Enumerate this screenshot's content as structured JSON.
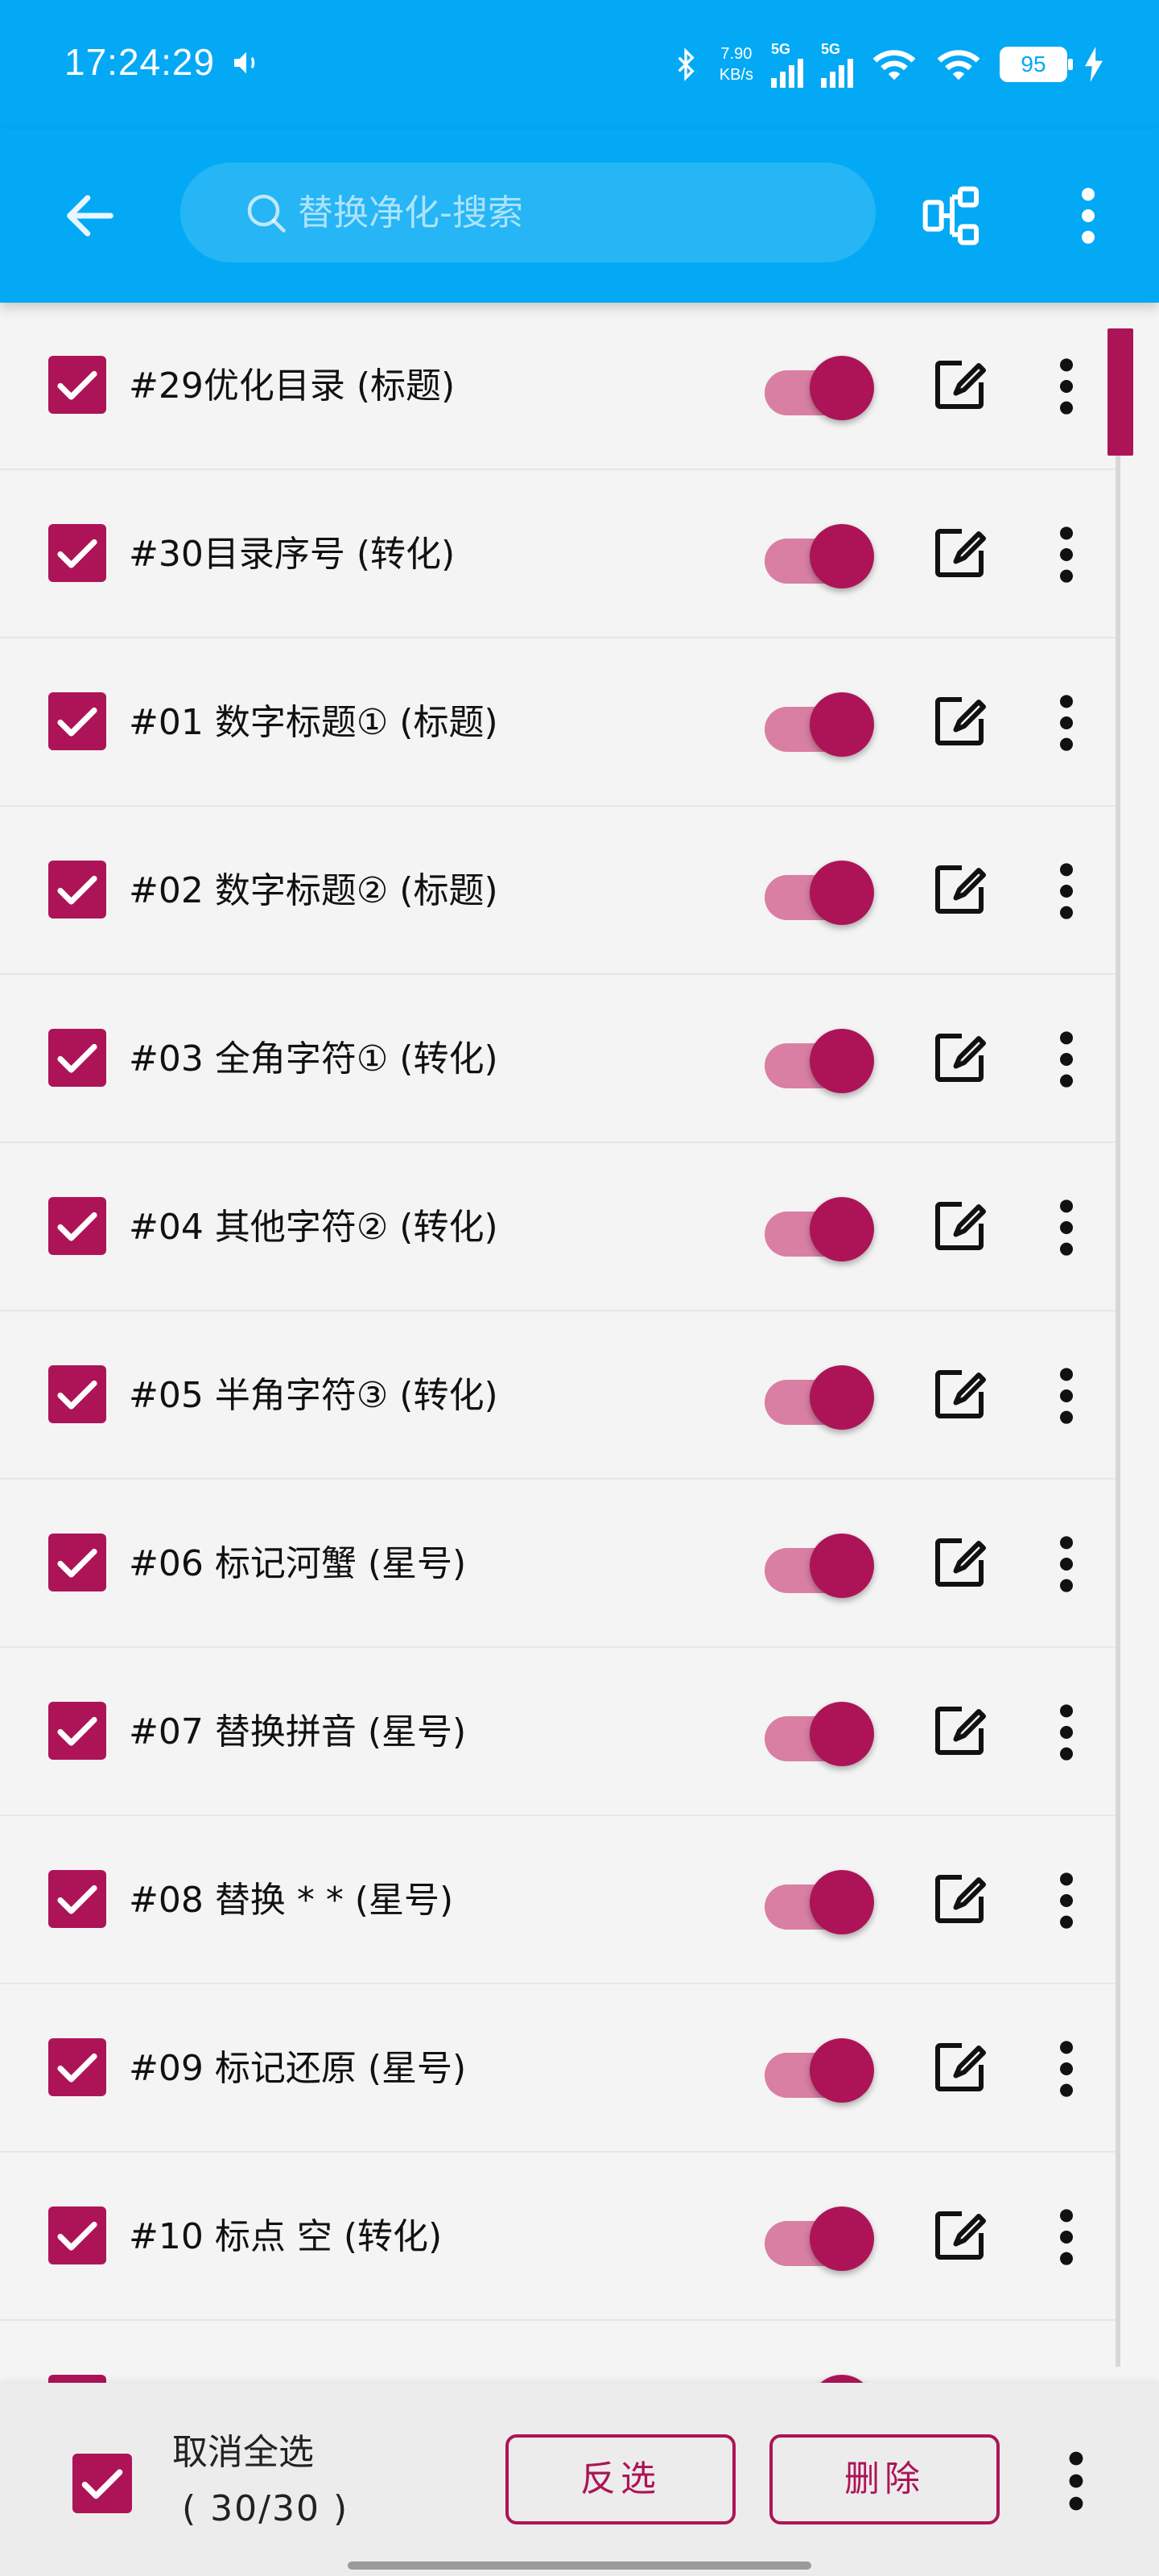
{
  "status_bar": {
    "time": "17:24:29",
    "net_speed_value": "7.90",
    "net_speed_unit": "KB/s",
    "sim1": "5G",
    "sim2": "5G",
    "battery": "95"
  },
  "app_bar": {
    "search_placeholder": "替换净化-搜索"
  },
  "rules": [
    {
      "label": "#29优化目录 (标题)",
      "checked": true,
      "enabled": true
    },
    {
      "label": "#30目录序号 (转化)",
      "checked": true,
      "enabled": true
    },
    {
      "label": "#01 数字标题① (标题)",
      "checked": true,
      "enabled": true
    },
    {
      "label": "#02 数字标题② (标题)",
      "checked": true,
      "enabled": true
    },
    {
      "label": "#03 全角字符① (转化)",
      "checked": true,
      "enabled": true
    },
    {
      "label": "#04 其他字符② (转化)",
      "checked": true,
      "enabled": true
    },
    {
      "label": "#05 半角字符③ (转化)",
      "checked": true,
      "enabled": true
    },
    {
      "label": "#06 标记河蟹 (星号)",
      "checked": true,
      "enabled": true
    },
    {
      "label": "#07 替换拼音 (星号)",
      "checked": true,
      "enabled": true
    },
    {
      "label": "#08 替换 * * (星号)",
      "checked": true,
      "enabled": true
    },
    {
      "label": "#09 标记还原 (星号)",
      "checked": true,
      "enabled": true
    },
    {
      "label": "#10 标点  空  (转化)",
      "checked": true,
      "enabled": true
    }
  ],
  "bottom_bar": {
    "select_all_label": "取消全选",
    "count": "( 30/30 )",
    "invert_label": "反选",
    "delete_label": "删除"
  },
  "colors": {
    "primary": "#03a9f4",
    "accent": "#ad1457",
    "switch_track": "#d97fa3"
  }
}
